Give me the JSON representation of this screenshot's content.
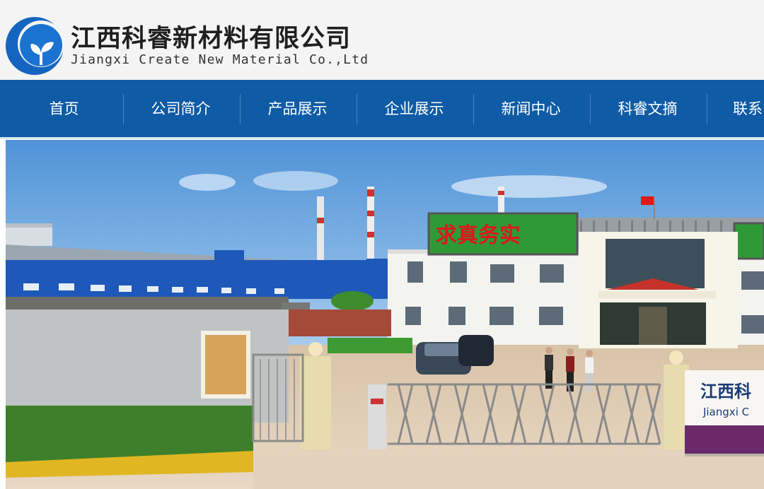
{
  "company": {
    "name_cn": "江西科睿新材料有限公司",
    "name_en": "Jiangxi Create New Material Co.,Ltd"
  },
  "nav": {
    "items": [
      {
        "label": "首页"
      },
      {
        "label": "公司简介"
      },
      {
        "label": "产品展示"
      },
      {
        "label": "企业展示"
      },
      {
        "label": "新闻中心"
      },
      {
        "label": "科睿文摘"
      },
      {
        "label": "联系"
      }
    ]
  },
  "banner": {
    "billboard_text": "求真务实",
    "gate_sign_cn": "江西科",
    "gate_sign_en": "Jiangxi C"
  },
  "colors": {
    "nav_bg": "#0f5ba6",
    "header_bg": "#f4f4f4",
    "logo_blue": "#1565c0"
  }
}
